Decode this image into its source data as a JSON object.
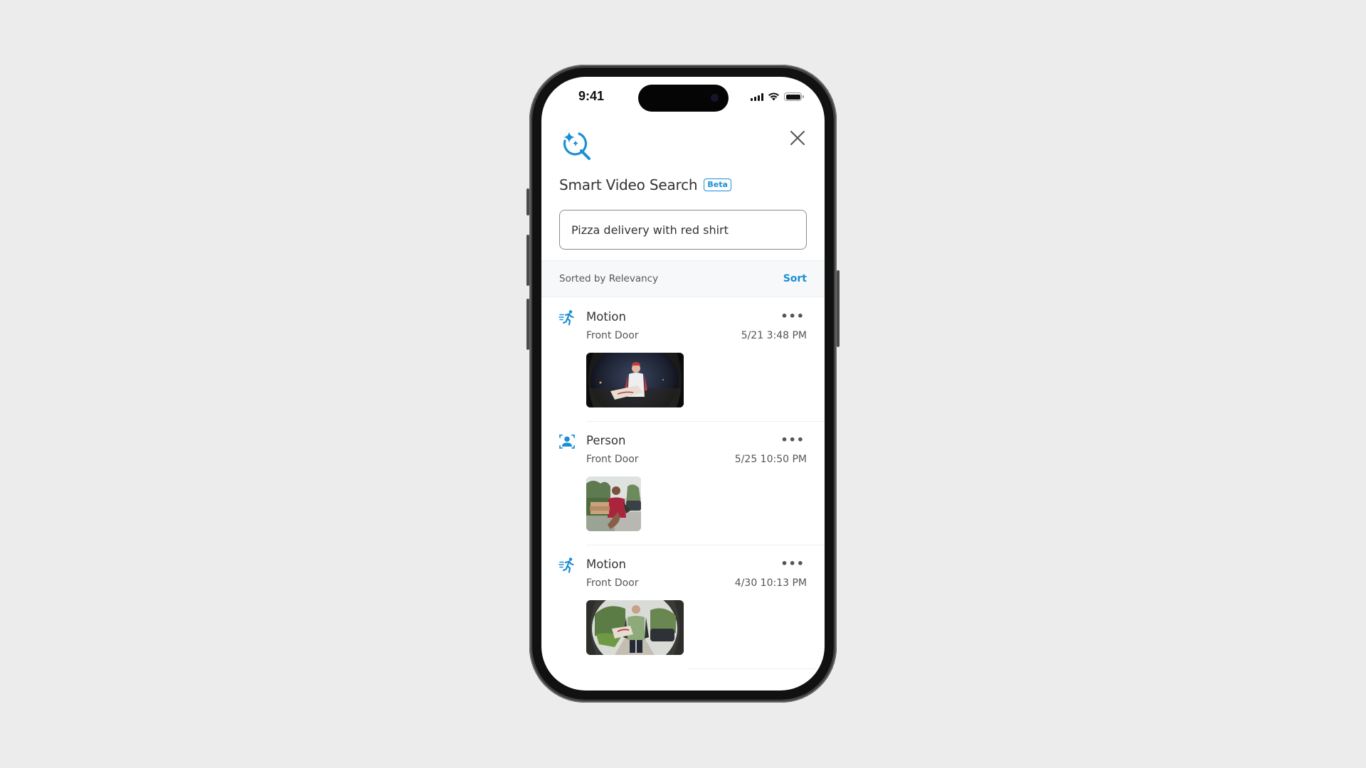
{
  "status_bar": {
    "time": "9:41"
  },
  "header": {
    "icon": "sparkle-search-icon",
    "close_icon": "close-icon",
    "title": "Smart Video Search",
    "badge": "Beta"
  },
  "search": {
    "value": "Pizza delivery with red shirt",
    "placeholder": ""
  },
  "sort_bar": {
    "label": "Sorted by Relevancy",
    "action": "Sort"
  },
  "colors": {
    "accent": "#1b8fd6",
    "text_primary": "#333333",
    "text_secondary": "#555555",
    "sort_bar_bg": "#f7f8fa",
    "page_bg": "#ececec"
  },
  "events": [
    {
      "type": "Motion",
      "icon": "motion-running-icon",
      "location": "Front Door",
      "timestamp": "5/21 3:48 PM",
      "more": "•••",
      "thumbnail": "night doorbell view, person in red shirt holding pizza box"
    },
    {
      "type": "Person",
      "icon": "person-detect-icon",
      "location": "Front Door",
      "timestamp": "5/25 10:50 PM",
      "more": "•••",
      "thumbnail": "daytime view, person in red shirt handing over pizza boxes"
    },
    {
      "type": "Motion",
      "icon": "motion-running-icon",
      "location": "Front Door",
      "timestamp": "4/30 10:13 PM",
      "more": "•••",
      "thumbnail": "daytime doorbell view, person in green shirt holding pizza box"
    }
  ]
}
